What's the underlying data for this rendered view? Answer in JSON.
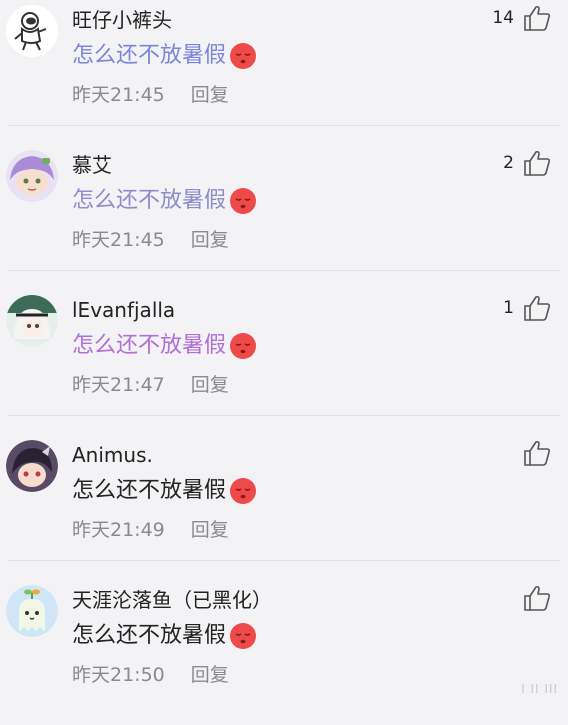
{
  "comments": [
    {
      "username": "旺仔小裤头",
      "text": "怎么还不放暑假",
      "time": "昨天21:45",
      "reply": "回复",
      "likes": "14",
      "text_color": "#7a86d8",
      "avatar_icon": "astronaut-avatar"
    },
    {
      "username": "慕艾",
      "text": "怎么还不放暑假",
      "time": "昨天21:45",
      "reply": "回复",
      "likes": "2",
      "text_color": "#8f8ac8",
      "avatar_icon": "anime-avatar-purple-hair"
    },
    {
      "username": "lEvanfjalla",
      "text": "怎么还不放暑假",
      "time": "昨天21:47",
      "reply": "回复",
      "likes": "1",
      "text_color": "#b06fd6",
      "avatar_icon": "anime-avatar-white-hair"
    },
    {
      "username": "Animus.",
      "text": "怎么还不放暑假",
      "time": "昨天21:49",
      "reply": "回复",
      "likes": "",
      "text_color": "#222222",
      "avatar_icon": "anime-avatar-dark-hair"
    },
    {
      "username": "天涯沦落鱼（已黑化）",
      "text": "怎么还不放暑假",
      "time": "昨天21:50",
      "reply": "回复",
      "likes": "",
      "text_color": "#222222",
      "avatar_icon": "ghost-sprout-avatar"
    }
  ],
  "emoji_icon": "sleepy-red-face-emoji",
  "like_icon": "thumbs-up-icon",
  "watermark_text": "Ⅰ ⅠⅠ ⅠⅠⅠ"
}
